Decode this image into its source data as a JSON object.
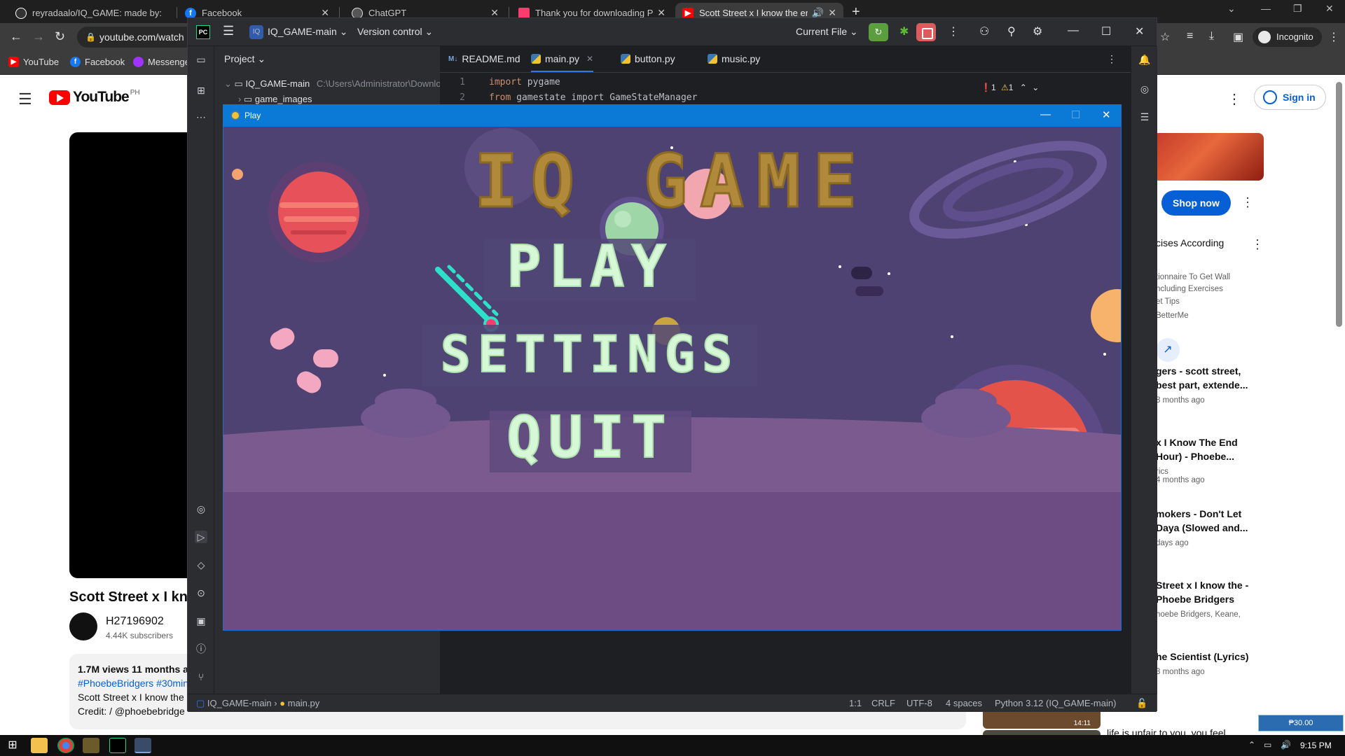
{
  "browser": {
    "tabs": [
      {
        "title": "reyradaalo/IQ_GAME: made by:",
        "icon": "github-icon",
        "color": "#ffffff"
      },
      {
        "title": "Facebook",
        "icon": "facebook-icon",
        "color": "#1877f2"
      },
      {
        "title": "ChatGPT",
        "icon": "chatgpt-icon",
        "color": "#ffffff"
      },
      {
        "title": "Thank you for downloading PyC",
        "icon": "pycharm-icon",
        "color": "#fc3b6e"
      },
      {
        "title": "Scott Street x I know the en",
        "icon": "youtube-icon",
        "color": "#ff0000"
      }
    ],
    "new_tab": "+",
    "url": "youtube.com/watch",
    "incognito_label": "Incognito",
    "bookmarks": [
      {
        "label": "YouTube",
        "icon": "youtube-icon"
      },
      {
        "label": "Facebook",
        "icon": "facebook-icon"
      },
      {
        "label": "Messenge",
        "icon": "messenger-icon"
      }
    ]
  },
  "youtube": {
    "logo_text": "YouTube",
    "logo_country": "PH",
    "sign_in": "Sign in",
    "video_title": "Scott Street x I kno",
    "channel": "H27196902",
    "subscribers": "4.44K subscribers",
    "views": "1.7M views  11 months a",
    "tags": "#PhoebeBridgers #30min",
    "desc_line": "Scott Street x I know the",
    "credit": "Credit:    / @phoebebridge",
    "ad": {
      "button": "Shop now",
      "title": "cises According",
      "lines": [
        "tionnaire To Get Wall",
        "ncluding Exercises",
        "et Tips",
        "BetterMe"
      ]
    },
    "recommendations": [
      {
        "title": "gers - scott street, best part, extende...",
        "meta": "8 months ago"
      },
      {
        "title": "x I Know The End Hour) - Phoebe...",
        "meta": "rics\n4 months ago"
      },
      {
        "title": "mokers - Don't Let Daya (Slowed and...",
        "meta": "days ago"
      },
      {
        "title": "Street x I know the - Phoebe Bridgers",
        "meta": "hoebe Bridgers, Keane,"
      },
      {
        "title": "he Scientist (Lyrics)",
        "meta": "3 months ago"
      }
    ],
    "last_rec": "life is unfair to you, you feel",
    "thumb_time": "14:11",
    "tray_badge": "₱30.00"
  },
  "ide": {
    "logo": "PC",
    "project_badge": "IQ",
    "project_name": "IQ_GAME-main",
    "vcs": "Version control",
    "run_config": "Current File",
    "project_panel_title": "Project",
    "tree_root": "IQ_GAME-main",
    "tree_root_path": "C:\\Users\\Administrator\\Downlo",
    "tree_child": "game_images",
    "tabs": [
      "README.md",
      "main.py",
      "button.py",
      "music.py"
    ],
    "code_lines": [
      {
        "num": "1",
        "kw": "import",
        "rest": " pygame"
      },
      {
        "num": "2",
        "kw": "from",
        "rest": " gamestate import GameStateManager"
      }
    ],
    "errors": "1",
    "warnings": "1",
    "status": {
      "breadcrumb_project": "IQ_GAME-main",
      "breadcrumb_file": "main.py",
      "position": "1:1",
      "line_sep": "CRLF",
      "encoding": "UTF-8",
      "indent": "4 spaces",
      "interpreter": "Python 3.12 (IQ_GAME-main)"
    }
  },
  "game": {
    "window_title": "Play",
    "title": "IQ GAME",
    "title_color": "#b08a3a",
    "buttons": [
      "PLAY",
      "SETTINGS",
      "QUIT"
    ],
    "button_text_color": "#d6f8d6",
    "bg_color": "#4e4272"
  },
  "taskbar": {
    "time": "9:15 PM"
  }
}
